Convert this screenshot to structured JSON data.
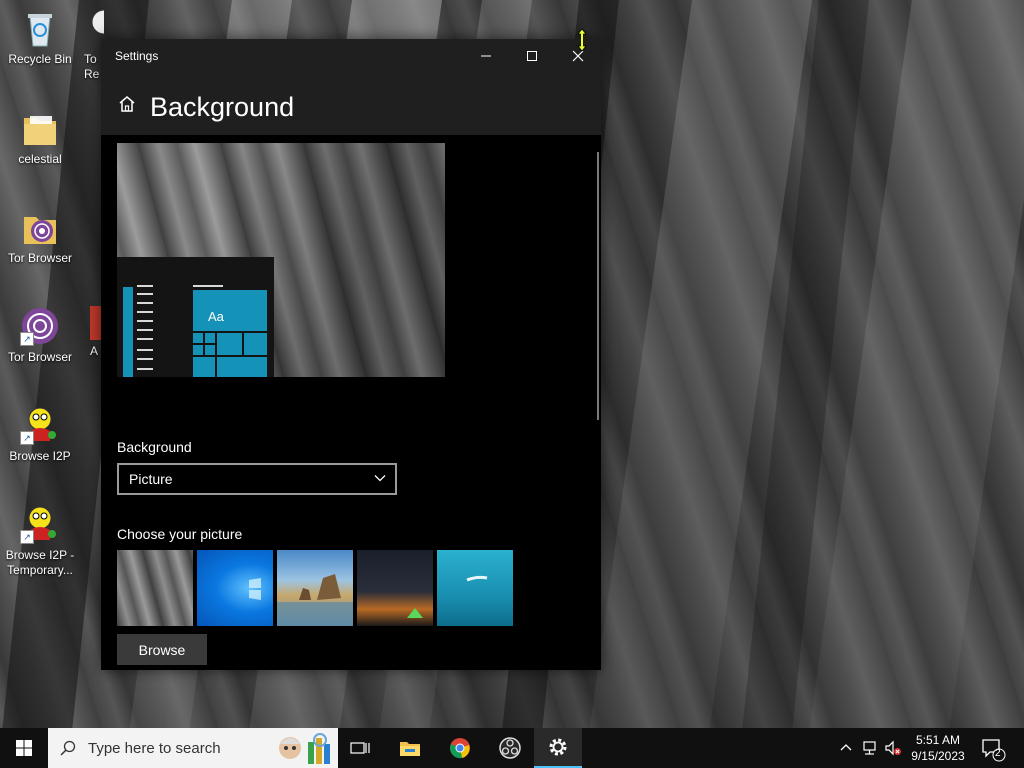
{
  "desktop": {
    "icons": [
      {
        "label": "Recycle Bin"
      },
      {
        "label": "celestial"
      },
      {
        "label": "Tor Browser"
      },
      {
        "label": "Tor Browser"
      },
      {
        "label": "Browse I2P"
      },
      {
        "label": "Browse I2P - Temporary..."
      }
    ],
    "partial_icons": [
      {
        "label": "To Re"
      },
      {
        "label": "A"
      }
    ]
  },
  "window": {
    "title": "Settings",
    "page_title": "Background",
    "preview_tile_text": "Aa",
    "background_label": "Background",
    "background_value": "Picture",
    "choose_label": "Choose your picture",
    "browse_label": "Browse",
    "thumbnails": [
      {
        "name": "rock-cliff"
      },
      {
        "name": "windows-blue"
      },
      {
        "name": "beach-rocks"
      },
      {
        "name": "night-sky-tent"
      },
      {
        "name": "underwater-swimmer"
      }
    ]
  },
  "taskbar": {
    "search_placeholder": "Type here to search",
    "time": "5:51 AM",
    "date": "9/15/2023",
    "notification_count": "2"
  },
  "colors": {
    "accent": "#1592b8",
    "window_bg": "#000000",
    "titlebar_bg": "#1f1f1f",
    "taskbar_bg": "#101010"
  }
}
